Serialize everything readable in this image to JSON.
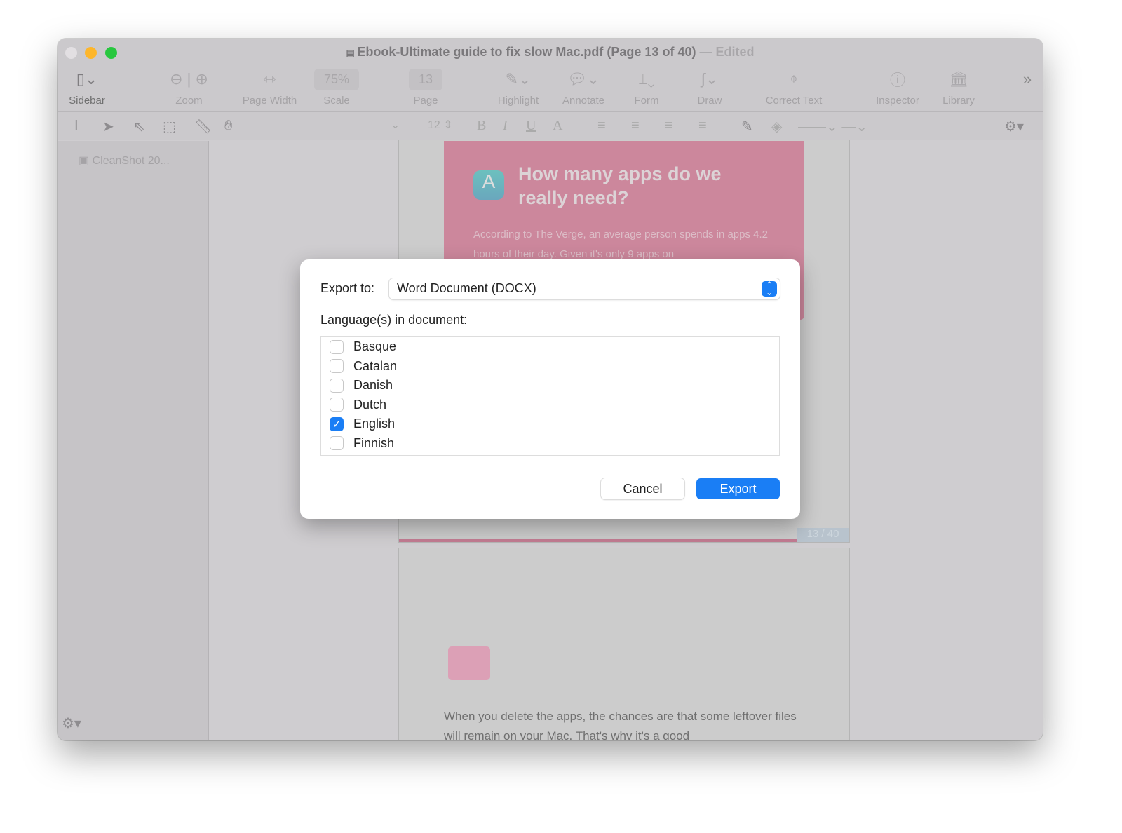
{
  "window": {
    "title": "Ebook-Ultimate guide to fix slow Mac.pdf (Page 13 of 40)",
    "edited": "Edited",
    "separator": "—"
  },
  "toolbar": {
    "sidebar": "Sidebar",
    "zoom": "Zoom",
    "page_width": "Page Width",
    "scale_value": "75%",
    "scale": "Scale",
    "page_value": "13",
    "page": "Page",
    "highlight": "Highlight",
    "annotate": "Annotate",
    "form": "Form",
    "draw": "Draw",
    "correct_text": "Correct Text",
    "inspector": "Inspector",
    "library": "Library"
  },
  "format_bar": {
    "font_size": "12",
    "bold": "B",
    "italic": "I",
    "underline": "U",
    "font_color": "A"
  },
  "sidebar": {
    "items": [
      {
        "label": "CleanShot 20..."
      }
    ]
  },
  "document": {
    "heading": "How many apps do we really need?",
    "paragraph": "According to The Verge, an average person spends in apps 4.2 hours of their day. Given it's only 9 apps on",
    "page_indicator": "13 / 40",
    "page2_text": "When you delete the apps, the chances are that some leftover files will remain on your Mac. That's why it's a good"
  },
  "dialog": {
    "export_label": "Export to:",
    "export_value": "Word Document (DOCX)",
    "languages_label": "Language(s) in document:",
    "languages": [
      {
        "name": "Basque",
        "checked": false
      },
      {
        "name": "Catalan",
        "checked": false
      },
      {
        "name": "Danish",
        "checked": false
      },
      {
        "name": "Dutch",
        "checked": false
      },
      {
        "name": "English",
        "checked": true
      },
      {
        "name": "Finnish",
        "checked": false
      }
    ],
    "cancel": "Cancel",
    "export": "Export"
  },
  "colors": {
    "accent": "#1a7ef5",
    "pink": "#cc879c"
  }
}
